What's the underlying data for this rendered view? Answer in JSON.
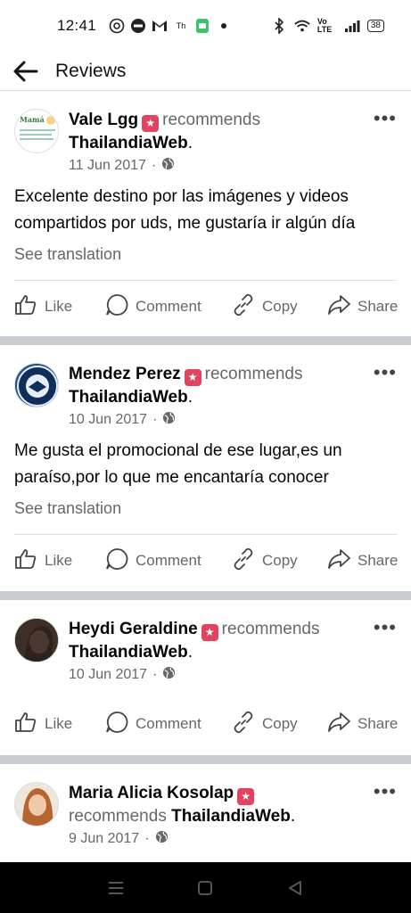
{
  "status": {
    "time": "12:41",
    "battery": "38",
    "net": "Vo LTE"
  },
  "header": {
    "title": "Reviews"
  },
  "reviews": [
    {
      "name": "Vale Lgg",
      "recommends": "recommends",
      "page": "ThailandiaWeb",
      "date": "11 Jun 2017",
      "text": "Excelente destino por las imágenes y videos compartidos por uds, me gustaría ir algún día",
      "translate": "See translation"
    },
    {
      "name": "Mendez Perez",
      "recommends": "recommends",
      "page": "ThailandiaWeb",
      "date": "10 Jun 2017",
      "text": "Me gusta el promocional de ese lugar,es un paraíso,por lo que me encantaría conocer",
      "translate": "See translation"
    },
    {
      "name": "Heydi Geraldine",
      "recommends": "recommends",
      "page": "ThailandiaWeb",
      "date": "10 Jun 2017"
    },
    {
      "name": "Maria Alicia Kosolap",
      "recommends": "recommends",
      "page": "ThailandiaWeb",
      "date": "9 Jun 2017"
    }
  ],
  "actions": {
    "like": "Like",
    "comment": "Comment",
    "copy": "Copy",
    "share": "Share"
  },
  "avatar_text": {
    "first": "Mamá"
  },
  "colors": {
    "badge": "#e0445e",
    "secondary_text": "#65676b",
    "separator": "#c9ccd1"
  }
}
